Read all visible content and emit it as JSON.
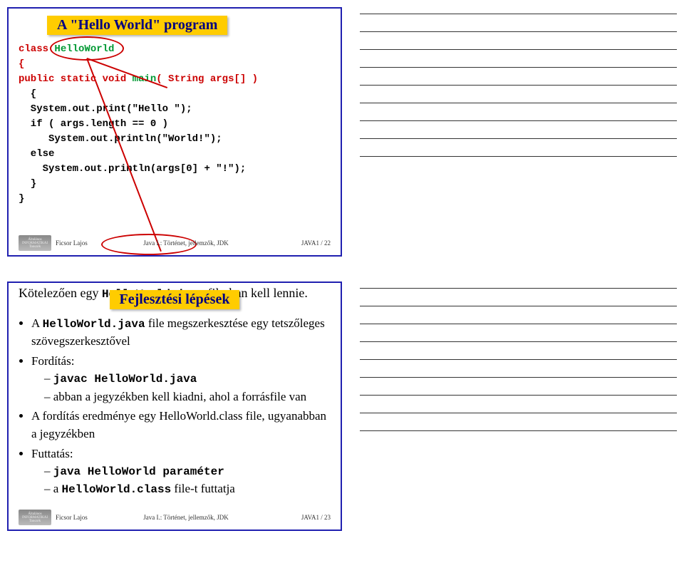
{
  "slide22": {
    "title": "A \"Hello World\" program",
    "code": {
      "l1a": "class ",
      "l1b": "HelloWorld",
      "l2": "{",
      "l3a": "public static void ",
      "l3b": "main",
      "l3c": "( String args[] )",
      "l4": "  {",
      "l5": "  System.out.print(\"Hello \");",
      "l6": "  if ( args.length == 0 )",
      "l7": "     System.out.println(\"World!\");",
      "l8": "  else",
      "l9": "    System.out.println(args[0] + \"!\");",
      "l10": "  }",
      "l11": "}"
    },
    "note_pre": "Kötelezően egy ",
    "note_file": "HelloWorld.java",
    "note_post": " file-ban kell lennie.",
    "footer_name": "Ficsor Lajos",
    "footer_center": "Java I.: Történet, jellemzők, JDK",
    "footer_right": "JAVA1 / 22"
  },
  "slide23": {
    "title": "Fejlesztési lépések",
    "b1_pre": "A ",
    "b1_mono": "HelloWorld.java",
    "b1_post": " file megszerkesztése egy tetszőleges szövegszerkesztővel",
    "b2": "Fordítás:",
    "b2s1": "javac HelloWorld.java",
    "b2s2": "abban a jegyzékben kell kiadni, ahol a forrásfile van",
    "b3": "A fordítás eredménye egy HelloWorld.class file, ugyanabban a jegyzékben",
    "b4": "Futtatás:",
    "b4s1": "java HelloWorld paraméter",
    "b4s2_pre": "a ",
    "b4s2_mono": "HelloWorld.class",
    "b4s2_post": " file-t futtatja",
    "footer_name": "Ficsor Lajos",
    "footer_center": "Java I.: Történet, jellemzők, JDK",
    "footer_right": "JAVA1 / 23"
  }
}
